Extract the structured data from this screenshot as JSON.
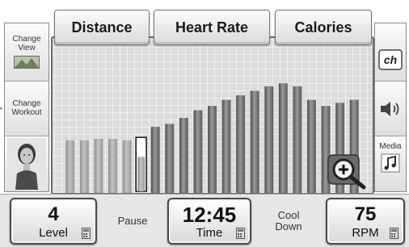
{
  "tabs": {
    "distance": "Distance",
    "heart_rate": "Heart Rate",
    "calories": "Calories"
  },
  "left_rail": {
    "change_view": "Change View",
    "change_workout": "Change Workout",
    "avatar_icon": "user-avatar"
  },
  "right_rail": {
    "channel_label": "ch",
    "volume_icon": "volume-icon",
    "media_label": "Media",
    "media_icon": "music-note-icon"
  },
  "chart_data": {
    "type": "bar",
    "values": [
      35,
      35,
      36,
      36,
      35,
      37,
      44,
      46,
      50,
      55,
      58,
      62,
      65,
      68,
      71,
      73,
      71,
      62,
      58,
      60,
      62
    ],
    "current_index": 5,
    "ylim": [
      0,
      100
    ]
  },
  "bottom": {
    "level": {
      "value": "4",
      "label": "Level"
    },
    "pause_label": "Pause",
    "time": {
      "value": "12:45",
      "label": "Time"
    },
    "cooldown_label": "Cool Down",
    "rpm": {
      "value": "75",
      "label": "RPM"
    }
  },
  "zoom_icon": "zoom-in-icon"
}
